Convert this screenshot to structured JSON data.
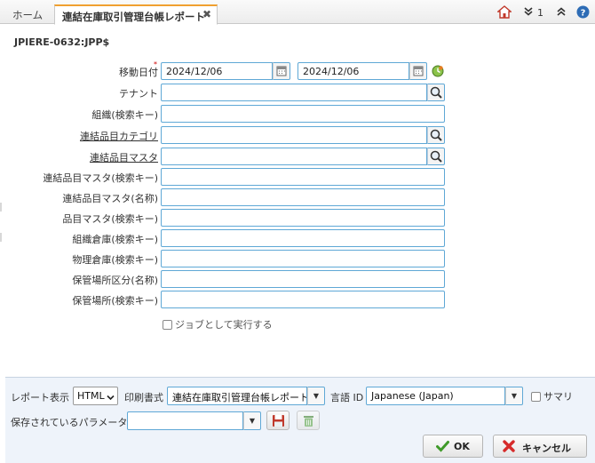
{
  "tabs": [
    {
      "label": "ホーム"
    },
    {
      "label": "連結在庫取引管理台帳レポート",
      "close": "✖"
    }
  ],
  "toolbar": {
    "count": "1"
  },
  "process": {
    "id": "JPIERE-0632:JPP$"
  },
  "form": {
    "move_date": {
      "label": "移動日付",
      "required": "*",
      "from": "2024/12/06",
      "to": "2024/12/06"
    },
    "fields": [
      {
        "label": "テナント"
      },
      {
        "label": "組織(検索キー)"
      },
      {
        "label": "連結品目カテゴリ"
      },
      {
        "label": "連結品目マスタ"
      },
      {
        "label": "連結品目マスタ(検索キー)"
      },
      {
        "label": "連結品目マスタ(名称)"
      },
      {
        "label": "品目マスタ(検索キー)"
      },
      {
        "label": "組織倉庫(検索キー)"
      },
      {
        "label": "物理倉庫(検索キー)"
      },
      {
        "label": "保管場所区分(名称)"
      },
      {
        "label": "保管場所(検索キー)"
      }
    ],
    "run_as_job": "ジョブとして実行する"
  },
  "bottom": {
    "report_display_label": "レポート表示",
    "report_display_value": "HTML",
    "print_format_label": "印刷書式",
    "print_format_value": "連結在庫取引管理台帳レポート",
    "language_label": "言語 ID",
    "language_value": "Japanese (Japan)",
    "summary_label": "サマリ",
    "saved_params_label": "保存されているパラメータ",
    "saved_params_value": "",
    "ok_label": "OK",
    "cancel_label": "キャンセル"
  },
  "colors": {
    "field_border": "#5fa8d6",
    "tab_accent": "#f0a030",
    "bottom_bg": "#eef3fa"
  }
}
